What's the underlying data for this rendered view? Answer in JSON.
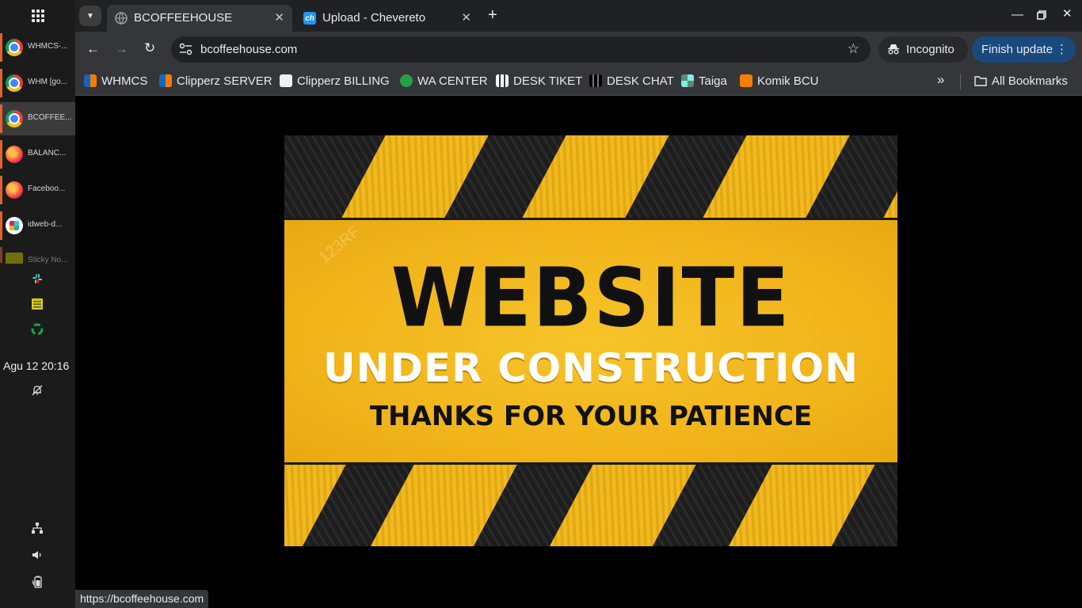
{
  "taskbar": {
    "apps": [
      {
        "label": "WHMCS-...",
        "icon": "chrome-icon"
      },
      {
        "label": "WHM [go...",
        "icon": "chrome-icon"
      },
      {
        "label": "BCOFFEE...",
        "icon": "chrome-icon",
        "active": true
      },
      {
        "label": "BALANC...",
        "icon": "firefox-icon"
      },
      {
        "label": "Faceboo...",
        "icon": "firefox-icon"
      },
      {
        "label": "idweb-d...",
        "icon": "slack-icon"
      },
      {
        "label": "Sticky No...",
        "icon": "sticky-notes-icon"
      }
    ],
    "tray_icons": [
      "slack-icon",
      "sticky-notes-icon",
      "recycle-icon",
      "notifications-off-icon",
      "network-icon",
      "volume-icon",
      "battery-icon"
    ],
    "clock": "Agu 12  20:16"
  },
  "browser": {
    "tabs": [
      {
        "title": "BCOFFEEHOUSE",
        "icon": "globe-icon",
        "active": true
      },
      {
        "title": "Upload - Chevereto",
        "icon": "chevereto-icon",
        "favicon_text": "ch"
      }
    ],
    "url": "bcoffeehouse.com",
    "incognito_label": "Incognito",
    "finish_update_label": "Finish update",
    "bookmarks": [
      {
        "label": "WHMCS",
        "icon": "whmcs-icon"
      },
      {
        "label": "Clipperz SERVER",
        "icon": "clipperz-icon"
      },
      {
        "label": "Clipperz BILLING",
        "icon": "clipperz-billing-icon"
      },
      {
        "label": "WA CENTER",
        "icon": "whatsapp-icon"
      },
      {
        "label": "DESK TIKET",
        "icon": "desk-icon"
      },
      {
        "label": "DESK CHAT",
        "icon": "desk-icon"
      },
      {
        "label": "Taiga",
        "icon": "taiga-icon"
      },
      {
        "label": "Komik BCU",
        "icon": "blogger-icon"
      }
    ],
    "all_bookmarks_label": "All Bookmarks",
    "status_url": "https://bcoffeehouse.com"
  },
  "page": {
    "banner": {
      "title": "WEBSITE",
      "subtitle": "UNDER CONSTRUCTION",
      "thanks": "THANKS FOR YOUR PATIENCE",
      "watermark": "123RF"
    }
  },
  "colors": {
    "accent_orange": "#e0622d",
    "banner_yellow": "#f4bc22",
    "update_button": "#1a4a7d"
  }
}
